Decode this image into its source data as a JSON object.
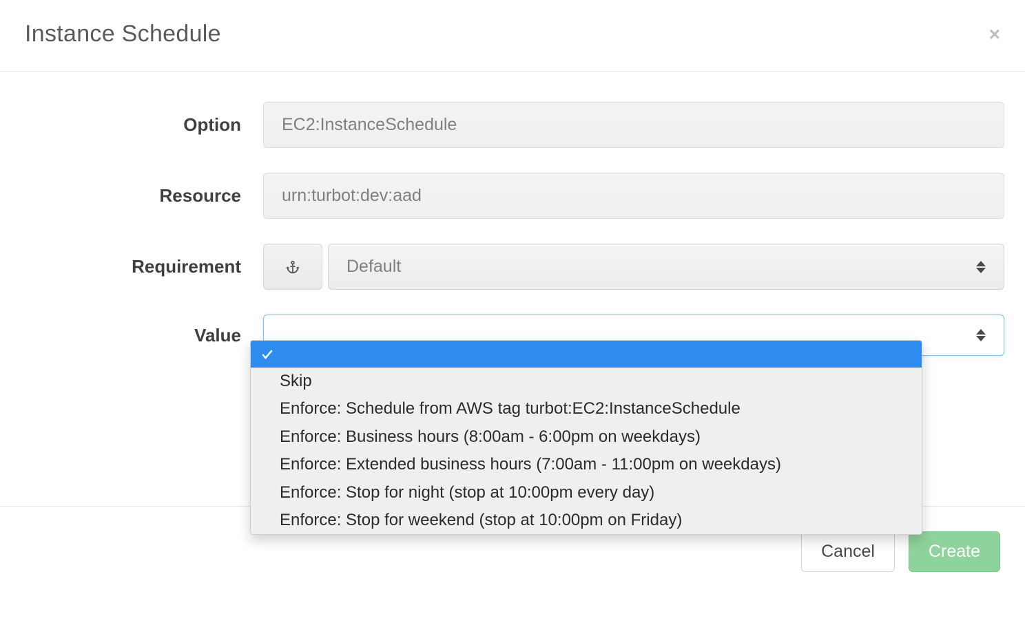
{
  "header": {
    "title": "Instance Schedule"
  },
  "form": {
    "option": {
      "label": "Option",
      "value": "EC2:InstanceSchedule"
    },
    "resource": {
      "label": "Resource",
      "value": "urn:turbot:dev:aad"
    },
    "requirement": {
      "label": "Requirement",
      "value": "Default"
    },
    "value": {
      "label": "Value"
    }
  },
  "dropdown": {
    "options": [
      "",
      "Skip",
      "Enforce: Schedule from AWS tag turbot:EC2:InstanceSchedule",
      "Enforce: Business hours (8:00am - 6:00pm on weekdays)",
      "Enforce: Extended business hours (7:00am - 11:00pm on weekdays)",
      "Enforce: Stop for night (stop at 10:00pm every day)",
      "Enforce: Stop for weekend (stop at 10:00pm on Friday)"
    ]
  },
  "footer": {
    "cancel": "Cancel",
    "create": "Create"
  }
}
